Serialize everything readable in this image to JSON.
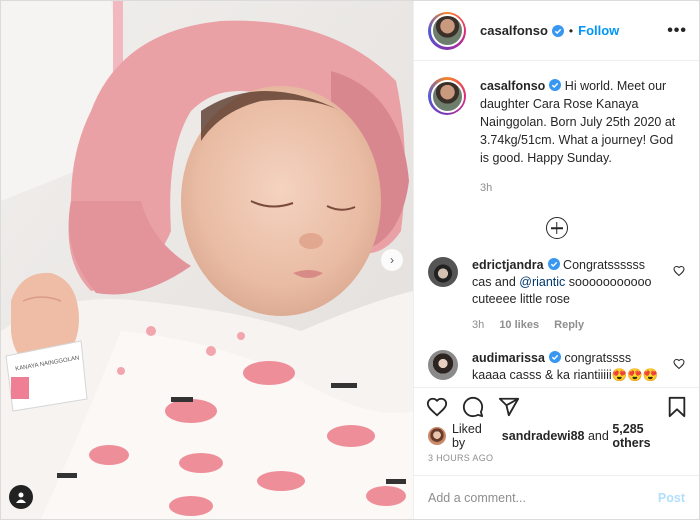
{
  "post": {
    "username": "casalfonso",
    "follow_label": "Follow",
    "more_label": "•••",
    "dot": "•"
  },
  "caption": {
    "username": "casalfonso",
    "text": "Hi world. Meet our daughter Cara Rose Kanaya Nainggolan. Born July 25th 2020 at 3.74kg/51cm. What a journey! God is good. Happy Sunday.",
    "time": "3h"
  },
  "comments": [
    {
      "username": "edrictjandra",
      "text_before": "Congratssssss cas and ",
      "mention": "@riantic",
      "text_after": " sooooooooooo cuteeee little rose",
      "time": "3h",
      "likes": "10 likes",
      "reply": "Reply"
    },
    {
      "username": "audimarissa",
      "text": "congratssss kaaaa casss & ka riantiiiii😍😍😍"
    }
  ],
  "likes": {
    "prefix": "Liked by ",
    "user": "sandradewi88",
    "mid": " and ",
    "count": "5,285 others"
  },
  "posted_ago": "3 HOURS AGO",
  "add_comment": {
    "placeholder": "Add a comment...",
    "post_label": "Post"
  },
  "photo": {
    "wristband_text": "KANAYA NAINGGOLAN"
  },
  "colors": {
    "link_blue": "#0095f6",
    "verified_blue": "#3897f0",
    "post_disabled": "#b2dffc",
    "hat_pink": "#eaa1a6"
  },
  "icons": [
    "verified-icon",
    "heart-icon",
    "comment-icon",
    "share-icon",
    "bookmark-icon",
    "load-more-icon",
    "chevron-right-icon",
    "user-tag-icon"
  ]
}
